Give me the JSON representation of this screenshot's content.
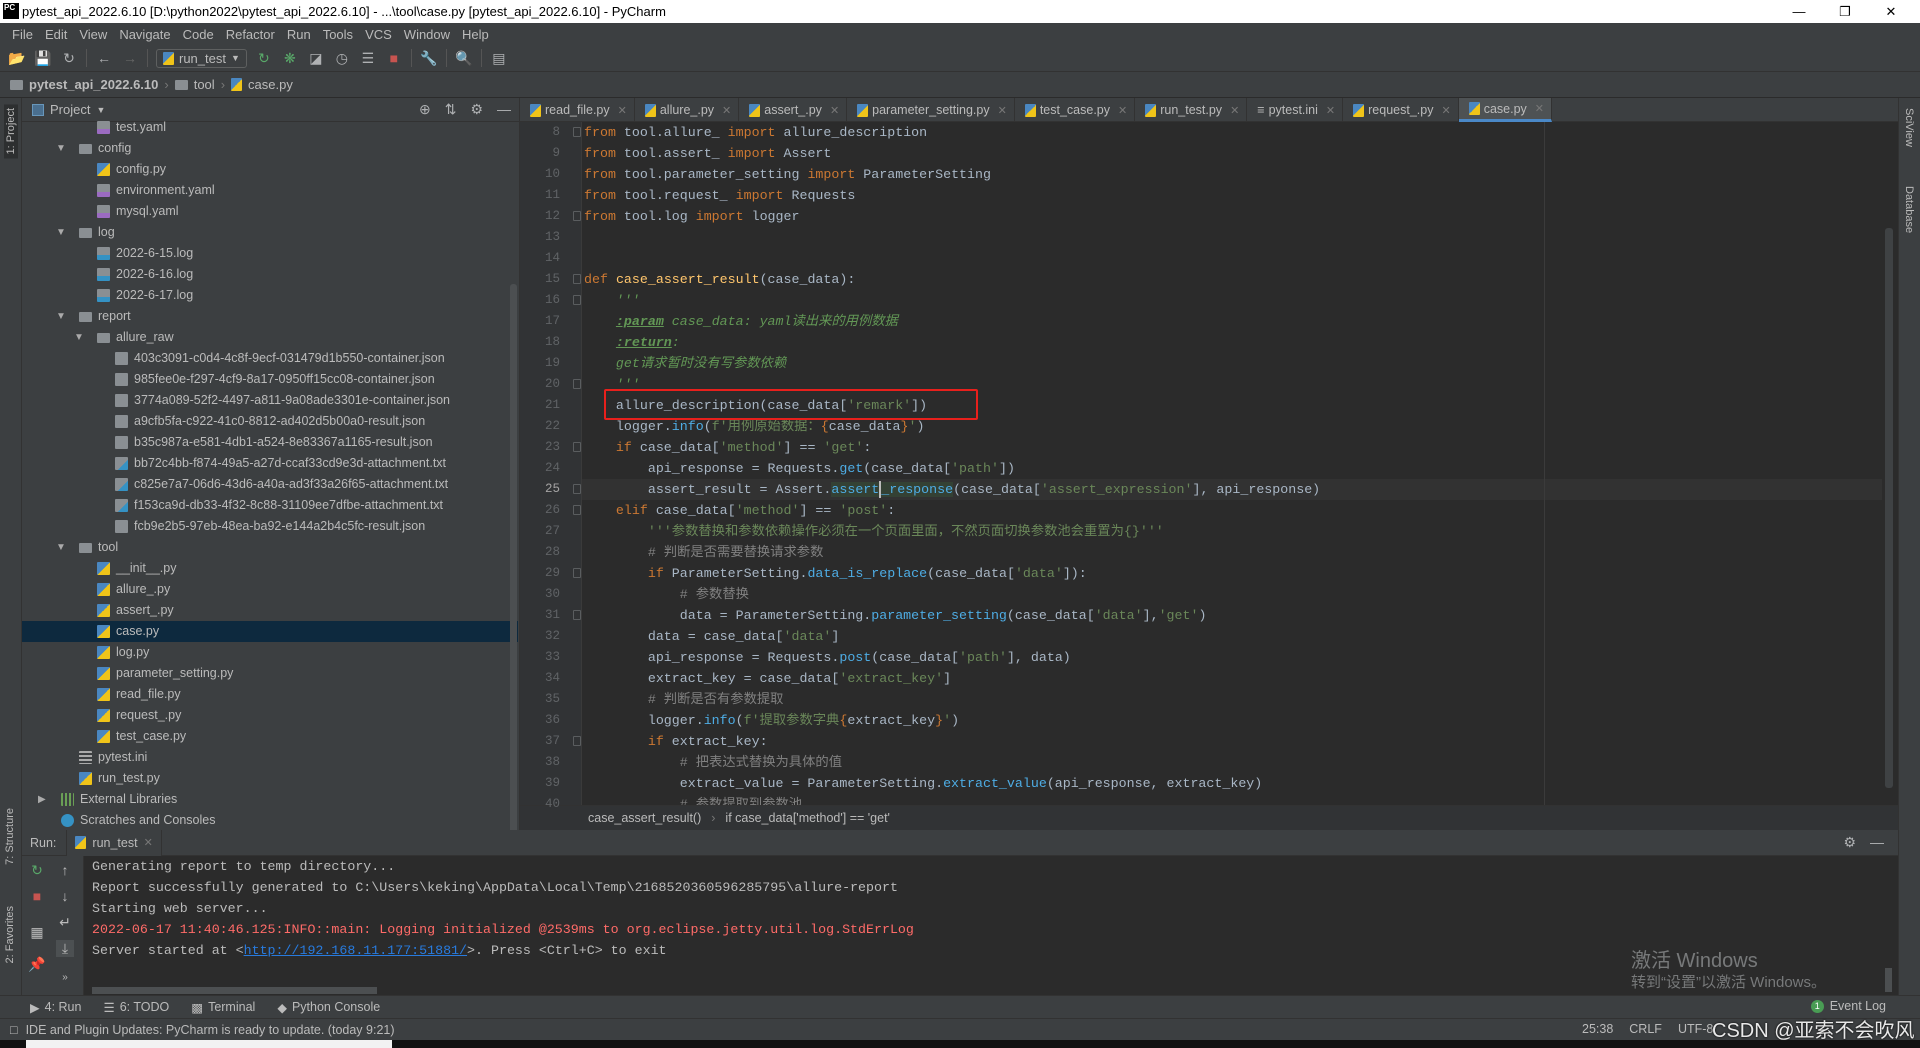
{
  "window": {
    "title": "pytest_api_2022.6.10 [D:\\python2022\\pytest_api_2022.6.10] - ...\\tool\\case.py [pytest_api_2022.6.10] - PyCharm",
    "app_icon": "PC"
  },
  "menu": [
    "File",
    "Edit",
    "View",
    "Navigate",
    "Code",
    "Refactor",
    "Run",
    "Tools",
    "VCS",
    "Window",
    "Help"
  ],
  "toolbar": {
    "run_config": "run_test"
  },
  "navbar": {
    "project": "pytest_api_2022.6.10",
    "folder": "tool",
    "file": "case.py"
  },
  "left_stripe": {
    "project": "1: Project",
    "structure": "7: Structure",
    "favorites": "2: Favorites"
  },
  "right_stripe": {
    "sciview": "SciView",
    "database": "Database"
  },
  "project_panel": {
    "title": "Project",
    "items": [
      {
        "label": "test.yaml",
        "depth": 2,
        "icon": "yaml"
      },
      {
        "label": "config",
        "depth": 1,
        "icon": "folder",
        "expanded": true
      },
      {
        "label": "config.py",
        "depth": 2,
        "icon": "py"
      },
      {
        "label": "environment.yaml",
        "depth": 2,
        "icon": "yaml"
      },
      {
        "label": "mysql.yaml",
        "depth": 2,
        "icon": "yaml"
      },
      {
        "label": "log",
        "depth": 1,
        "icon": "folder",
        "expanded": true
      },
      {
        "label": "2022-6-15.log",
        "depth": 2,
        "icon": "log"
      },
      {
        "label": "2022-6-16.log",
        "depth": 2,
        "icon": "log"
      },
      {
        "label": "2022-6-17.log",
        "depth": 2,
        "icon": "log"
      },
      {
        "label": "report",
        "depth": 1,
        "icon": "folder",
        "expanded": true
      },
      {
        "label": "allure_raw",
        "depth": 2,
        "icon": "folder",
        "expanded": true
      },
      {
        "label": "403c3091-c0d4-4c8f-9ecf-031479d1b550-container.json",
        "depth": 3,
        "icon": "json"
      },
      {
        "label": "985fee0e-f297-4cf9-8a17-0950ff15cc08-container.json",
        "depth": 3,
        "icon": "json"
      },
      {
        "label": "3774a089-52f2-4497-a811-9a08ade3301e-container.json",
        "depth": 3,
        "icon": "json"
      },
      {
        "label": "a9cfb5fa-c922-41c0-8812-ad402d5b00a0-result.json",
        "depth": 3,
        "icon": "json"
      },
      {
        "label": "b35c987a-e581-4db1-a524-8e83367a1165-result.json",
        "depth": 3,
        "icon": "json"
      },
      {
        "label": "bb72c4bb-f874-49a5-a27d-ccaf33cd9e3d-attachment.txt",
        "depth": 3,
        "icon": "txt"
      },
      {
        "label": "c825e7a7-06d6-43d6-a40a-ad3f33a26f65-attachment.txt",
        "depth": 3,
        "icon": "txt"
      },
      {
        "label": "f153ca9d-db33-4f32-8c88-31109ee7dfbe-attachment.txt",
        "depth": 3,
        "icon": "txt"
      },
      {
        "label": "fcb9e2b5-97eb-48ea-ba92-e144a2b4c5fc-result.json",
        "depth": 3,
        "icon": "json"
      },
      {
        "label": "tool",
        "depth": 1,
        "icon": "folder",
        "expanded": true
      },
      {
        "label": "__init__.py",
        "depth": 2,
        "icon": "py"
      },
      {
        "label": "allure_.py",
        "depth": 2,
        "icon": "py"
      },
      {
        "label": "assert_.py",
        "depth": 2,
        "icon": "py"
      },
      {
        "label": "case.py",
        "depth": 2,
        "icon": "py",
        "selected": true
      },
      {
        "label": "log.py",
        "depth": 2,
        "icon": "py"
      },
      {
        "label": "parameter_setting.py",
        "depth": 2,
        "icon": "py"
      },
      {
        "label": "read_file.py",
        "depth": 2,
        "icon": "py"
      },
      {
        "label": "request_.py",
        "depth": 2,
        "icon": "py"
      },
      {
        "label": "test_case.py",
        "depth": 2,
        "icon": "py"
      },
      {
        "label": "pytest.ini",
        "depth": 1,
        "icon": "ini"
      },
      {
        "label": "run_test.py",
        "depth": 1,
        "icon": "py"
      },
      {
        "label": "External Libraries",
        "depth": 0,
        "icon": "lib",
        "expanded": false
      },
      {
        "label": "Scratches and Consoles",
        "depth": 0,
        "icon": "scratch"
      }
    ]
  },
  "editor": {
    "tabs": [
      {
        "label": "read_file.py",
        "icon": "py"
      },
      {
        "label": "allure_.py",
        "icon": "py"
      },
      {
        "label": "assert_.py",
        "icon": "py"
      },
      {
        "label": "parameter_setting.py",
        "icon": "py"
      },
      {
        "label": "test_case.py",
        "icon": "py"
      },
      {
        "label": "run_test.py",
        "icon": "py"
      },
      {
        "label": "pytest.ini",
        "icon": "ini"
      },
      {
        "label": "request_.py",
        "icon": "py"
      },
      {
        "label": "case.py",
        "icon": "py",
        "active": true
      }
    ],
    "current_line": 25,
    "highlighted_line": 21,
    "lines": [
      {
        "n": 8,
        "fold": true,
        "t": [
          [
            "from",
            "kw"
          ],
          [
            " tool.allure_ ",
            ""
          ],
          [
            "import",
            "kw"
          ],
          [
            " allure_description",
            ""
          ]
        ]
      },
      {
        "n": 9,
        "t": [
          [
            "from",
            "kw"
          ],
          [
            " tool.assert_ ",
            ""
          ],
          [
            "import",
            "kw"
          ],
          [
            " Assert",
            ""
          ]
        ]
      },
      {
        "n": 10,
        "t": [
          [
            "from",
            "kw"
          ],
          [
            " tool.parameter_setting ",
            ""
          ],
          [
            "import",
            "kw"
          ],
          [
            " ParameterSetting",
            ""
          ]
        ]
      },
      {
        "n": 11,
        "t": [
          [
            "from",
            "kw"
          ],
          [
            " tool.request_ ",
            ""
          ],
          [
            "import",
            "kw"
          ],
          [
            " Requests",
            ""
          ]
        ]
      },
      {
        "n": 12,
        "fold": true,
        "t": [
          [
            "from",
            "kw"
          ],
          [
            " tool.log ",
            ""
          ],
          [
            "import",
            "kw"
          ],
          [
            " logger",
            ""
          ]
        ]
      },
      {
        "n": 13,
        "t": []
      },
      {
        "n": 14,
        "t": []
      },
      {
        "n": 15,
        "fold": true,
        "t": [
          [
            "def",
            "kw"
          ],
          [
            " ",
            ""
          ],
          [
            "case_assert_result",
            "fn"
          ],
          [
            "(case_data):",
            ""
          ]
        ]
      },
      {
        "n": 16,
        "fold": true,
        "t": [
          [
            "    ",
            ""
          ],
          [
            "'''",
            "doc"
          ]
        ]
      },
      {
        "n": 17,
        "t": [
          [
            "    ",
            ""
          ],
          [
            ":param",
            "doctag"
          ],
          [
            " case_data: yaml读出来的用例数据",
            "doc"
          ]
        ]
      },
      {
        "n": 18,
        "t": [
          [
            "    ",
            ""
          ],
          [
            ":return",
            "doctag"
          ],
          [
            ":",
            "doc"
          ]
        ]
      },
      {
        "n": 19,
        "t": [
          [
            "    ",
            ""
          ],
          [
            "get请求暂时没有写参数依赖",
            "doc"
          ]
        ]
      },
      {
        "n": 20,
        "fold": true,
        "t": [
          [
            "    ",
            ""
          ],
          [
            "'''",
            "doc"
          ]
        ]
      },
      {
        "n": 21,
        "t": [
          [
            "    allure_description(case_data[",
            ""
          ],
          [
            "'remark'",
            "str"
          ],
          [
            "])",
            ""
          ]
        ]
      },
      {
        "n": 22,
        "t": [
          [
            "    logger.",
            ""
          ],
          [
            "info",
            "m"
          ],
          [
            "(",
            ""
          ],
          [
            "f'用例原始数据：",
            "str"
          ],
          [
            "{",
            "fb"
          ],
          [
            "case_data",
            ""
          ],
          [
            "}",
            "fb"
          ],
          [
            "'",
            "str"
          ],
          [
            ")",
            ""
          ]
        ]
      },
      {
        "n": 23,
        "fold": true,
        "t": [
          [
            "    ",
            ""
          ],
          [
            "if",
            "kw"
          ],
          [
            " case_data[",
            ""
          ],
          [
            "'method'",
            "str"
          ],
          [
            "] == ",
            ""
          ],
          [
            "'get'",
            "str"
          ],
          [
            ":",
            ""
          ]
        ]
      },
      {
        "n": 24,
        "t": [
          [
            "        api_response = Requests.",
            ""
          ],
          [
            "get",
            "m"
          ],
          [
            "(case_data[",
            ""
          ],
          [
            "'path'",
            "str"
          ],
          [
            "])",
            ""
          ]
        ]
      },
      {
        "n": 25,
        "fold": true,
        "t": [
          [
            "        assert_result = Assert.",
            ""
          ],
          [
            "assert",
            "m hl"
          ],
          [
            "caret",
            "caret"
          ],
          [
            "_response",
            "m hl"
          ],
          [
            "(case_data[",
            ""
          ],
          [
            "'assert_expression'",
            "str"
          ],
          [
            "], api_response)",
            ""
          ]
        ]
      },
      {
        "n": 26,
        "fold": true,
        "t": [
          [
            "    ",
            ""
          ],
          [
            "elif",
            "kw"
          ],
          [
            " case_data[",
            ""
          ],
          [
            "'method'",
            "str"
          ],
          [
            "] == ",
            ""
          ],
          [
            "'post'",
            "str"
          ],
          [
            ":",
            ""
          ]
        ]
      },
      {
        "n": 27,
        "t": [
          [
            "        ",
            ""
          ],
          [
            "'''参数替换和参数依赖操作必须在一个页面里面，不然页面切换参数池会重置为{}'''",
            "str"
          ]
        ]
      },
      {
        "n": 28,
        "t": [
          [
            "        ",
            ""
          ],
          [
            "# 判断是否需要替换请求参数",
            "cm"
          ]
        ]
      },
      {
        "n": 29,
        "fold": true,
        "t": [
          [
            "        ",
            ""
          ],
          [
            "if",
            "kw"
          ],
          [
            " ParameterSetting.",
            ""
          ],
          [
            "data_is_replace",
            "m"
          ],
          [
            "(case_data[",
            ""
          ],
          [
            "'data'",
            "str"
          ],
          [
            "]):",
            ""
          ]
        ]
      },
      {
        "n": 30,
        "t": [
          [
            "            ",
            ""
          ],
          [
            "# 参数替换",
            "cm"
          ]
        ]
      },
      {
        "n": 31,
        "fold": true,
        "t": [
          [
            "            data = ParameterSetting.",
            ""
          ],
          [
            "parameter_setting",
            "m"
          ],
          [
            "(case_data[",
            ""
          ],
          [
            "'data'",
            "str"
          ],
          [
            "],",
            ""
          ],
          [
            "'get'",
            "str"
          ],
          [
            ")",
            ""
          ]
        ]
      },
      {
        "n": 32,
        "t": [
          [
            "        data = case_data[",
            ""
          ],
          [
            "'data'",
            "str"
          ],
          [
            "]",
            ""
          ]
        ]
      },
      {
        "n": 33,
        "t": [
          [
            "        api_response = Requests.",
            ""
          ],
          [
            "post",
            "m"
          ],
          [
            "(case_data[",
            ""
          ],
          [
            "'path'",
            "str"
          ],
          [
            "], data)",
            ""
          ]
        ]
      },
      {
        "n": 34,
        "t": [
          [
            "        extract_key = case_data[",
            ""
          ],
          [
            "'extract_key'",
            "str"
          ],
          [
            "]",
            ""
          ]
        ]
      },
      {
        "n": 35,
        "t": [
          [
            "        ",
            ""
          ],
          [
            "# 判断是否有参数提取",
            "cm"
          ]
        ]
      },
      {
        "n": 36,
        "t": [
          [
            "        logger.",
            ""
          ],
          [
            "info",
            "m"
          ],
          [
            "(",
            ""
          ],
          [
            "f'提取参数字典",
            "str"
          ],
          [
            "{",
            "fb"
          ],
          [
            "extract_key",
            ""
          ],
          [
            "}",
            "fb"
          ],
          [
            "'",
            "str"
          ],
          [
            ")",
            ""
          ]
        ]
      },
      {
        "n": 37,
        "fold": true,
        "t": [
          [
            "        ",
            ""
          ],
          [
            "if",
            "kw"
          ],
          [
            " extract_key:",
            ""
          ]
        ]
      },
      {
        "n": 38,
        "t": [
          [
            "            ",
            ""
          ],
          [
            "# 把表达式替换为具体的值",
            "cm"
          ]
        ]
      },
      {
        "n": 39,
        "t": [
          [
            "            extract_value = ParameterSetting.",
            ""
          ],
          [
            "extract_value",
            "m"
          ],
          [
            "(api_response, extract_key)",
            ""
          ]
        ]
      },
      {
        "n": 40,
        "t": [
          [
            "            ",
            ""
          ],
          [
            "# 参数提取到参数池",
            "cm"
          ]
        ]
      }
    ],
    "breadcrumb": [
      "case_assert_result()",
      "if case_data['method'] == 'get'"
    ]
  },
  "run_panel": {
    "label": "Run:",
    "tab": "run_test",
    "output": [
      {
        "text": "Generating report to temp directory...",
        "type": "normal"
      },
      {
        "text": "Report successfully generated to C:\\Users\\keking\\AppData\\Local\\Temp\\2168520360596285795\\allure-report",
        "type": "normal"
      },
      {
        "text": "Starting web server...",
        "type": "normal"
      },
      {
        "text": "2022-06-17 11:40:46.125:INFO::main: Logging initialized @2539ms to org.eclipse.jetty.util.log.StdErrLog",
        "type": "error"
      }
    ],
    "server_line": {
      "prefix": "Server started at <",
      "link": "http://192.168.11.177:51881/",
      "suffix": ">. Press <Ctrl+C> to exit"
    }
  },
  "bottom_tabs": [
    "4: Run",
    "6: TODO",
    "Terminal",
    "Python Console"
  ],
  "event_log": {
    "count": "1",
    "label": "Event Log"
  },
  "status": {
    "message": "IDE and Plugin Updates: PyCharm is ready to update. (today 9:21)",
    "position": "25:38",
    "line_sep": "CRLF",
    "encoding": "UTF-8"
  },
  "watermarks": {
    "activate_title": "激活 Windows",
    "activate_sub": "转到“设置”以激活 Windows。",
    "csdn": "CSDN @亚索不会吹风"
  },
  "colors": {
    "accent": "#4a88c7",
    "highlight_box": "#e8201c",
    "selection": "#0d293e",
    "keyword": "#cc7832",
    "string": "#6a8759",
    "error": "#ff6b68",
    "link": "#287bde"
  }
}
